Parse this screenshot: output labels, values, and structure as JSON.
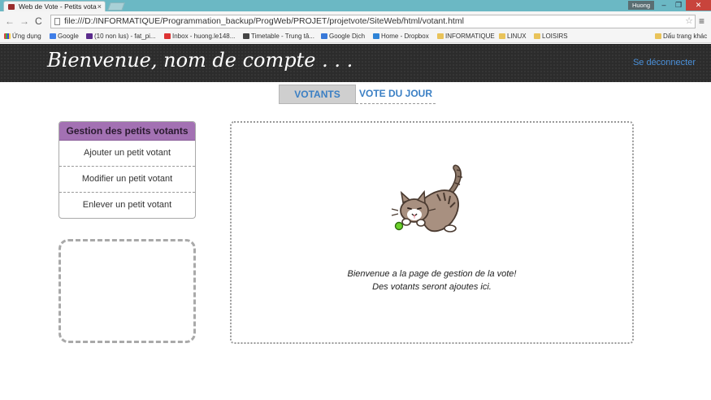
{
  "browser": {
    "tab_title": "Web de Vote - Petits vota",
    "tab_close": "×",
    "user_badge": "Huong",
    "win_min": "–",
    "win_max": "❐",
    "win_close": "✕",
    "url": "file:///D:/INFORMATIQUE/Programmation_backup/ProgWeb/PROJET/projetvote/SiteWeb/html/votant.html",
    "nav_back": "←",
    "nav_forward": "→",
    "nav_reload": "C",
    "star_icon": "☆",
    "menu_icon": "≡",
    "bookmarks": [
      {
        "label": "Ứng dụng",
        "icon": "apps-icon"
      },
      {
        "label": "Google",
        "icon": "google-icon"
      },
      {
        "label": "(10 non lus) - fat_pi...",
        "icon": "mail-icon"
      },
      {
        "label": "Inbox - huong.le148...",
        "icon": "gmail-icon"
      },
      {
        "label": "Timetable - Trung tâ...",
        "icon": "timetable-icon"
      },
      {
        "label": "Google Dịch",
        "icon": "translate-icon"
      },
      {
        "label": "Home - Dropbox",
        "icon": "dropbox-icon"
      },
      {
        "label": "INFORMATIQUE",
        "icon": "folder-icon"
      },
      {
        "label": "LINUX",
        "icon": "folder-icon"
      },
      {
        "label": "LOISIRS",
        "icon": "folder-icon"
      }
    ],
    "other_bookmarks": "Dấu trang khác"
  },
  "header": {
    "welcome": "Bienvenue, nom de compte . . .",
    "logout": "Se déconnecter"
  },
  "tabs": [
    {
      "label": "VOTANTS",
      "active": true
    },
    {
      "label": "VOTE DU JOUR",
      "active": false
    }
  ],
  "sidebar": {
    "title": "Gestion des petits votants",
    "items": [
      {
        "label": "Ajouter un petit votant"
      },
      {
        "label": "Modifier un petit votant"
      },
      {
        "label": "Enlever un petit votant"
      }
    ]
  },
  "main": {
    "line1": "Bienvenue a la page de gestion de la vote!",
    "line2": "Des votants seront ajoutes ici."
  },
  "colors": {
    "header_bg": "#2c2c2c",
    "accent_purple": "#a371b3",
    "link_blue": "#3a7fc4",
    "titlebar": "#6bb8c4"
  }
}
